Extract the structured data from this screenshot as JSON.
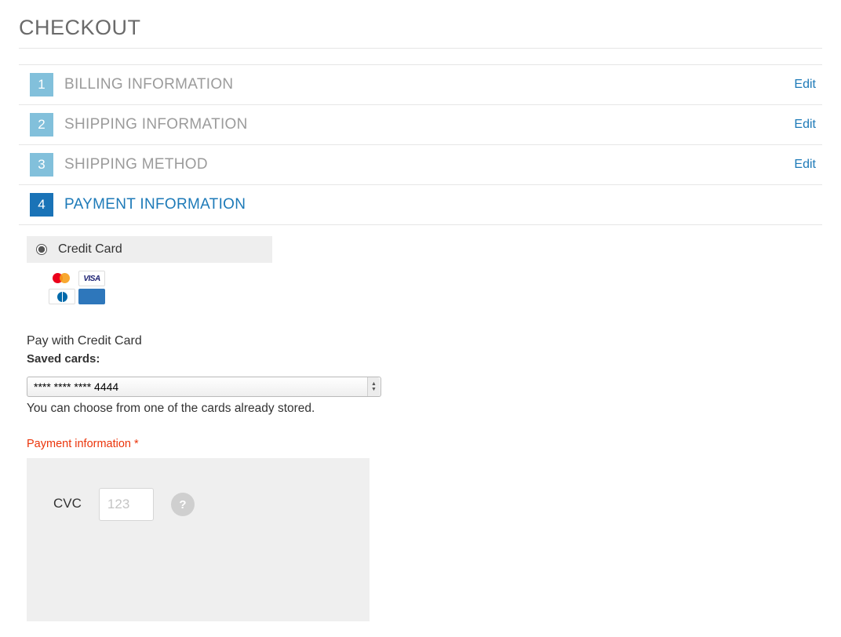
{
  "page_title": "CHECKOUT",
  "steps": [
    {
      "num": "1",
      "label": "BILLING INFORMATION",
      "edit": "Edit",
      "active": false
    },
    {
      "num": "2",
      "label": "SHIPPING INFORMATION",
      "edit": "Edit",
      "active": false
    },
    {
      "num": "3",
      "label": "SHIPPING METHOD",
      "edit": "Edit",
      "active": false
    },
    {
      "num": "4",
      "label": "PAYMENT INFORMATION",
      "edit": "",
      "active": true
    }
  ],
  "payment": {
    "method_label": "Credit Card",
    "pay_heading": "Pay with Credit Card",
    "saved_cards_label": "Saved cards:",
    "saved_card_selected": "**** **** **** 4444",
    "saved_hint": "You can choose from one of the cards already stored.",
    "payment_info_label": "Payment information *",
    "cvc_label": "CVC",
    "cvc_placeholder": "123",
    "help_glyph": "?"
  },
  "card_brands": [
    "mastercard",
    "visa",
    "diners-club",
    "amex"
  ]
}
